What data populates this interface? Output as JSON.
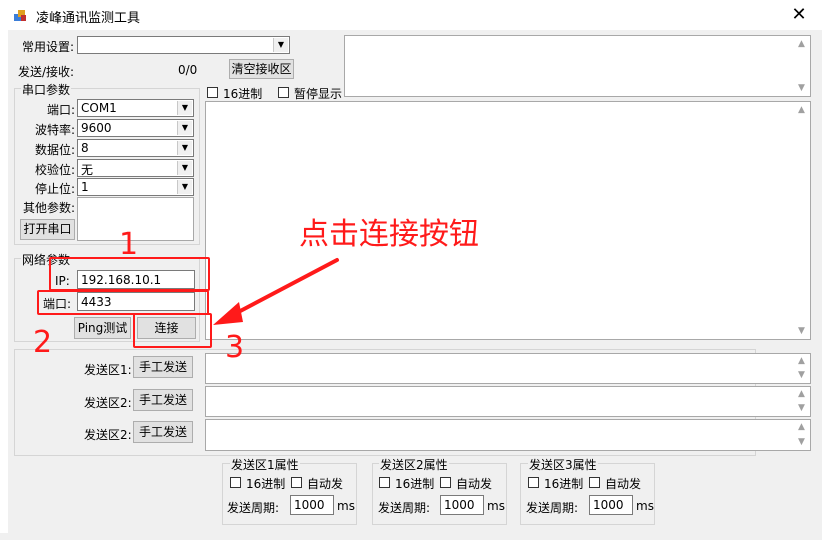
{
  "window": {
    "title": "凌峰通讯监测工具",
    "close": "✕"
  },
  "top": {
    "common_settings_label": "常用设置:",
    "send_recv_label": "发送/接收:",
    "counter": "0/0",
    "clear_recv_label": "清空接收区",
    "hex_label": "16进制",
    "pause_label": "暂停显示"
  },
  "serial": {
    "group_title": "串口参数",
    "port_label": "端口:",
    "port_value": "COM1",
    "baud_label": "波特率:",
    "baud_value": "9600",
    "data_bits_label": "数据位:",
    "data_bits_value": "8",
    "parity_label": "校验位:",
    "parity_value": "无",
    "stop_bits_label": "停止位:",
    "stop_bits_value": "1",
    "other_label": "其他参数:",
    "open_button": "打开串口"
  },
  "network": {
    "group_title": "网络参数",
    "ip_label": "IP:",
    "ip_value": "192.168.10.1",
    "port_label": "端口:",
    "port_value": "4433",
    "ping_button": "Ping测试",
    "connect_button": "连接"
  },
  "send": {
    "rows": [
      {
        "label": "发送区1:",
        "button": "手工发送"
      },
      {
        "label": "发送区2:",
        "button": "手工发送"
      },
      {
        "label": "发送区2:",
        "button": "手工发送"
      }
    ]
  },
  "props": [
    {
      "title": "发送区1属性",
      "hex": "16进制",
      "auto": "自动发",
      "period_label": "发送周期:",
      "period": "1000",
      "unit": "ms"
    },
    {
      "title": "发送区2属性",
      "hex": "16进制",
      "auto": "自动发",
      "period_label": "发送周期:",
      "period": "1000",
      "unit": "ms"
    },
    {
      "title": "发送区3属性",
      "hex": "16进制",
      "auto": "自动发",
      "period_label": "发送周期:",
      "period": "1000",
      "unit": "ms"
    }
  ],
  "annotations": {
    "callout": "点击连接按钮",
    "n1": "1",
    "n2": "2",
    "n3": "3",
    "color": "#ff1a1a"
  }
}
